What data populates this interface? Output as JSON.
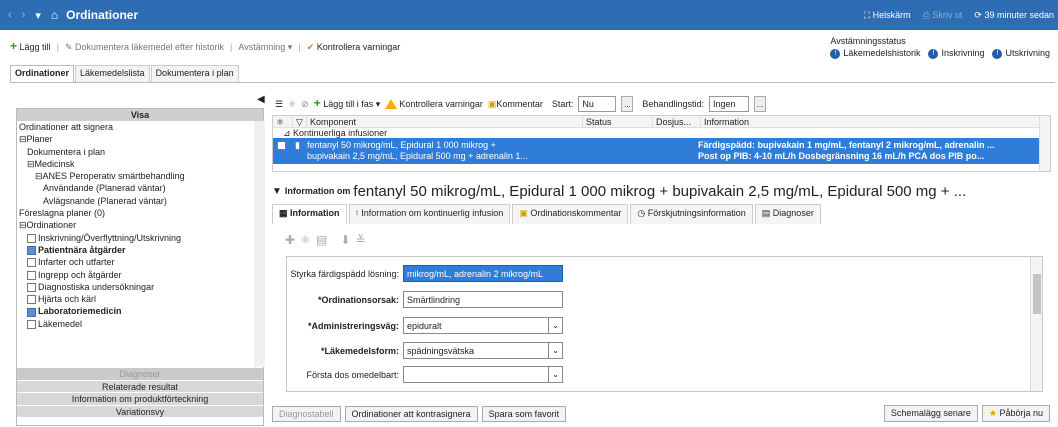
{
  "titlebar": {
    "title": "Ordinationer",
    "fullscreen": "Helskärm",
    "dim_label": "Skriv ut",
    "timer": "39 minuter sedan"
  },
  "toolbar": {
    "add": "Lägg till",
    "document_history": "Dokumentera läkemedel efter historik",
    "reconcile": "Avstämning",
    "check_warnings": "Kontrollera varningar"
  },
  "reconciliation": {
    "title": "Avstämningsstatus",
    "items": [
      "Läkemedelshistorik",
      "Inskrivning",
      "Utskrivning"
    ]
  },
  "tabs": [
    "Ordinationer",
    "Läkemedelslista",
    "Dokumentera i plan"
  ],
  "left_panel": {
    "header": "Visa",
    "items": [
      {
        "label": "Ordinationer att signera",
        "indent": 0,
        "cb": "none",
        "bold": false
      },
      {
        "label": "Planer",
        "indent": 0,
        "cb": "minus",
        "bold": false
      },
      {
        "label": "Dokumentera i plan",
        "indent": 1,
        "cb": "none",
        "bold": false
      },
      {
        "label": "Medicinsk",
        "indent": 1,
        "cb": "minus",
        "bold": false
      },
      {
        "label": "ANES Peroperativ smärtbehandling",
        "indent": 2,
        "cb": "minus",
        "bold": false
      },
      {
        "label": "Användande (Planerad väntar)",
        "indent": 3,
        "cb": "none",
        "bold": false
      },
      {
        "label": "Avlägsnande (Planerad väntar)",
        "indent": 3,
        "cb": "none",
        "bold": false
      },
      {
        "label": "Föreslagna planer (0)",
        "indent": 0,
        "cb": "none",
        "bold": false
      },
      {
        "label": "Ordinationer",
        "indent": 0,
        "cb": "minus",
        "bold": false
      },
      {
        "label": "Inskrivning/Överflyttning/Utskrivning",
        "indent": 1,
        "cb": "off",
        "bold": false
      },
      {
        "label": "Patientnära åtgärder",
        "indent": 1,
        "cb": "on",
        "bold": true
      },
      {
        "label": "Infarter och utfarter",
        "indent": 1,
        "cb": "off",
        "bold": false
      },
      {
        "label": "Ingrepp och åtgärder",
        "indent": 1,
        "cb": "off",
        "bold": false
      },
      {
        "label": "Diagnostiska undersökningar",
        "indent": 1,
        "cb": "off",
        "bold": false
      },
      {
        "label": "Hjärta och kärl",
        "indent": 1,
        "cb": "off",
        "bold": false
      },
      {
        "label": "Laboratoriemedicin",
        "indent": 1,
        "cb": "on",
        "bold": true
      },
      {
        "label": "Läkemedel",
        "indent": 1,
        "cb": "off",
        "bold": false
      }
    ],
    "footer": [
      "Diagnoser",
      "Relaterade resultat",
      "Information om produktförteckning",
      "Variationsvy"
    ]
  },
  "right_toolbar": {
    "add_phase": "Lägg till i fas",
    "check_warnings": "Kontrollera varningar",
    "comment": "Kommentar",
    "start_label": "Start:",
    "start_value": "Nu",
    "duration_label": "Behandlingstid:",
    "duration_value": "Ingen"
  },
  "table": {
    "columns": [
      "Komponent",
      "Status",
      "Dosjus...",
      "Information"
    ],
    "group": "Kontinuerliga infusioner",
    "row": {
      "component_line1": "fentanyl 50 mikrog/mL, Epidural 1 000 mikrog +",
      "component_line2": "bupivakain 2,5 mg/mL, Epidural 500 mg + adrenalin 1...",
      "info_line1": "Färdigspädd: bupivakain 1 mg/mL, fentanyl 2 mikrog/mL, adrenalin ...",
      "info_line2": "Post op PIB: 4-10 mL/h  Dosbegränsning 16 mL/h  PCA dos  PIB po..."
    }
  },
  "info": {
    "prefix": "Information om",
    "title": "fentanyl 50 mikrog/mL, Epidural 1 000 mikrog + bupivakain 2,5 mg/mL, Epidural 500 mg + ...",
    "tabs": [
      "Information",
      "Information om kontinuerlig infusion",
      "Ordinationskommentar",
      "Förskjutningsinformation",
      "Diagnoser"
    ]
  },
  "form": {
    "strength_label": "Styrka färdigspädd lösning:",
    "strength_value": "mikrog/mL, adrenalin 2 mikrog/mL",
    "reason_label": "*Ordinationsorsak:",
    "reason_value": "Smärtlindring",
    "route_label": "*Administreringsväg:",
    "route_value": "epiduralt",
    "form_label": "*Läkemedelsform:",
    "form_value": "spädningsvätska",
    "first_dose_label": "Första dos omedelbart:",
    "first_dose_value": ""
  },
  "bottom": {
    "diag_table": "Diagnostabell",
    "to_cosign": "Ordinationer att kontrasignera",
    "save_fav": "Spara som favorit",
    "schedule_later": "Schemalägg senare",
    "start_now": "Påbörja nu"
  }
}
